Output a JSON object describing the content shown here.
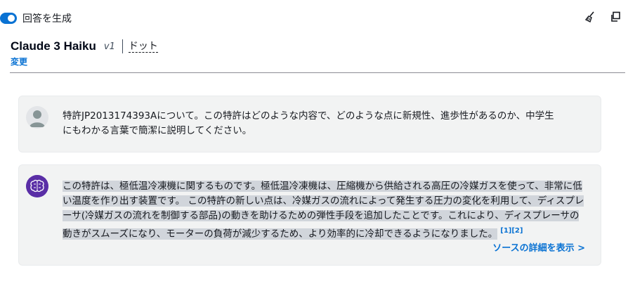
{
  "header": {
    "toggle_label": "回答を生成",
    "toggle_on": true,
    "accent_color": "#0972d3"
  },
  "tools": {
    "clear_icon": "broom-icon",
    "copy_icon": "copy-icon"
  },
  "model": {
    "name": "Claude 3 Haiku",
    "version": "v1",
    "mode": "ドット",
    "change_label": "変更"
  },
  "messages": {
    "user": {
      "text": "特許JP2013174393Aについて。この特許はどのような内容で、どのような点に新規性、進歩性があるのか、中学生にもわかる言葉で簡潔に説明してください。"
    },
    "assistant": {
      "text": "この特許は、極低温冷凍機に関するものです。極低温冷凍機は、圧縮機から供給される高圧の冷媒ガスを使って、非常に低い温度を作り出す装置です。 この特許の新しい点は、冷媒ガスの流れによって発生する圧力の変化を利用して、ディスプレーサ(冷媒ガスの流れを制御する部品)の動きを助けるための弾性手段を追加したことです。これにより、ディスプレーサの動きがスムーズになり、モーターの負荷が減少するため、より効率的に冷却できるようになりました。",
      "citations": "[1][2]",
      "source_link": "ソースの詳細を表示 >"
    }
  }
}
